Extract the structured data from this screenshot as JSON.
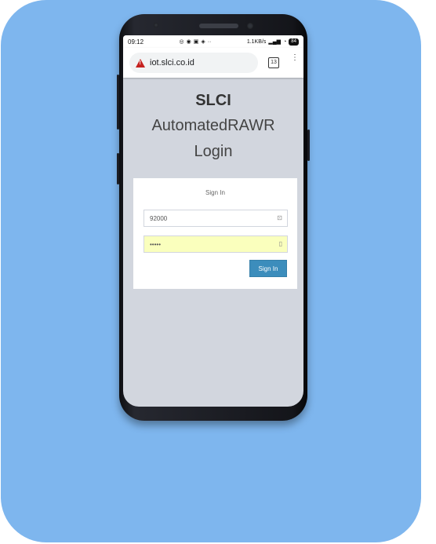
{
  "status_bar": {
    "time": "09:12",
    "net_speed": "1.1KB/s",
    "battery": "84"
  },
  "browser": {
    "url": "iot.slci.co.id",
    "tab_count": "13",
    "menu_glyph": "⋮"
  },
  "brand": {
    "title": "SLCI",
    "subtitle": "AutomatedRAWR",
    "login_heading": "Login"
  },
  "form": {
    "heading": "Sign In",
    "username_value": "92000",
    "password_value": "•••••",
    "signin_label": "Sign In"
  },
  "colors": {
    "backdrop": "#7eb6ee",
    "accent": "#3c8dbc",
    "autofill": "#faffbd"
  }
}
